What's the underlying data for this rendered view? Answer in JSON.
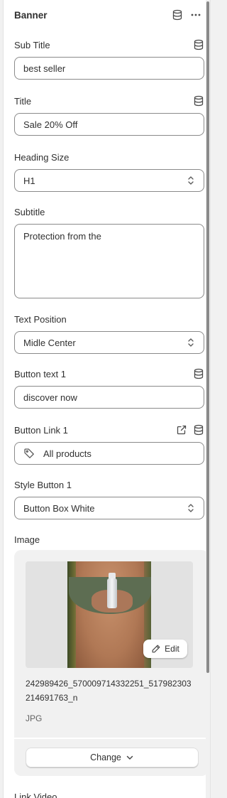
{
  "section": {
    "title": "Banner"
  },
  "fields": {
    "sub_title": {
      "label": "Sub Title",
      "value": "best seller"
    },
    "title": {
      "label": "Title",
      "value": "Sale 20% Off"
    },
    "heading_size": {
      "label": "Heading Size",
      "value": "H1"
    },
    "subtitle": {
      "label": "Subtitle",
      "value": "Protection from the"
    },
    "text_position": {
      "label": "Text Position",
      "value": "Midle Center"
    },
    "button_text_1": {
      "label": "Button text 1",
      "value": "discover now"
    },
    "button_link_1": {
      "label": "Button Link 1",
      "value": "All products"
    },
    "style_button_1": {
      "label": "Style Button 1",
      "value": "Button Box White"
    },
    "image": {
      "label": "Image",
      "edit_label": "Edit",
      "filename": "242989426_570009714332251_517982303214691763_n",
      "filetype": "JPG",
      "change_label": "Change"
    },
    "link_video": {
      "label": "Link Video"
    }
  },
  "icons": {
    "database": "database-icon",
    "more": "more-horizontal-icon",
    "external": "external-link-icon",
    "tag": "tag-icon",
    "select": "select-chevron-icon",
    "pencil": "pencil-icon",
    "chevron_down": "chevron-down-icon"
  },
  "colors": {
    "panel_bg": "#ffffff",
    "page_bg": "#f1f1f1",
    "border": "#8a8a8a",
    "text": "#303030"
  }
}
